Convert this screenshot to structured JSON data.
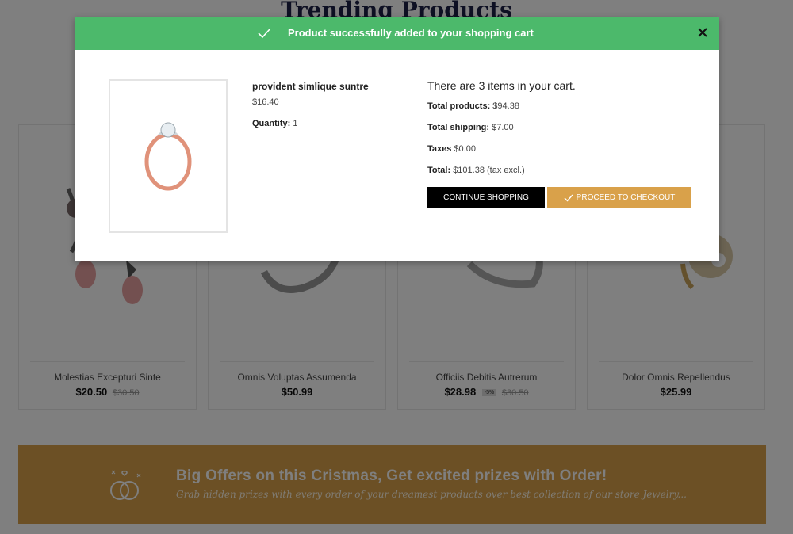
{
  "background": {
    "section_title": "Trending Products",
    "products": [
      {
        "name": "Molestias Excepturi Sinte",
        "price": "$20.50",
        "old_price": "$30.50",
        "discount": ""
      },
      {
        "name": "Omnis Voluptas Assumenda",
        "price": "$50.99",
        "old_price": "",
        "discount": ""
      },
      {
        "name": "Officiis Debitis Autrerum",
        "price": "$28.98",
        "old_price": "$30.50",
        "discount": "-5%"
      },
      {
        "name": "Dolor Omnis Repellendus",
        "price": "$25.99",
        "old_price": "",
        "discount": ""
      }
    ],
    "offer": {
      "headline": "Big Offers on this Cristmas, Get excited prizes with Order!",
      "subline": "Grab hidden prizes with every order of your dreamest products over best collection of our store Jewelry..."
    }
  },
  "modal": {
    "header_text": "Product successfully added to your shopping cart",
    "product_name": "provident simlique suntre",
    "product_price": "$16.40",
    "quantity_label": "Quantity:",
    "quantity_value": "1",
    "cart_count_text": "There are 3 items in your cart.",
    "total_products_label": "Total products:",
    "total_products_value": "$94.38",
    "total_shipping_label": "Total shipping:",
    "total_shipping_value": "$7.00",
    "taxes_label": "Taxes",
    "taxes_value": "$0.00",
    "total_label": "Total:",
    "total_value": "$101.38 (tax excl.)",
    "continue_label": "CONTINUE SHOPPING",
    "checkout_label": "PROCEED TO CHECKOUT"
  },
  "colors": {
    "header_green": "#4cb96b",
    "accent_gold": "#d9a14a",
    "title_navy": "#1d2046"
  },
  "icons": [
    "check-icon",
    "close-icon",
    "rings-icon"
  ]
}
